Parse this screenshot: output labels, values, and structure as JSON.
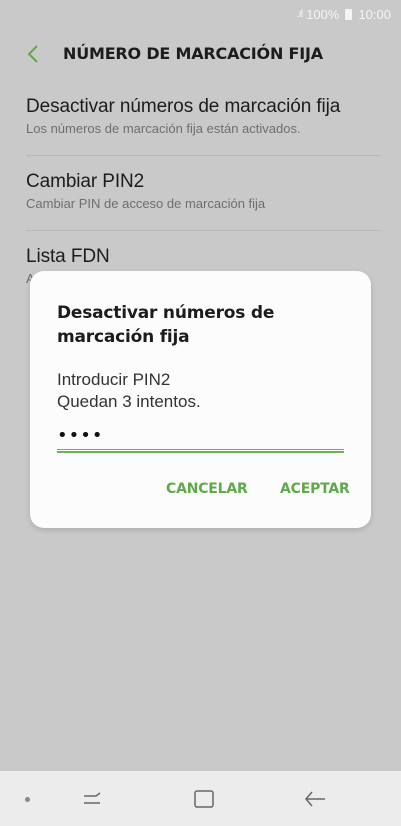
{
  "status_bar": {
    "signal": ".ıl",
    "battery": "100%",
    "time": "10:00"
  },
  "header": {
    "title": "NÚMERO DE MARCACIÓN FIJA"
  },
  "list": {
    "items": [
      {
        "title": "Desactivar números de marcación fija",
        "subtitle": "Los números de marcación fija están activados."
      },
      {
        "title": "Cambiar PIN2",
        "subtitle": "Cambiar PIN de acceso de marcación fija"
      },
      {
        "title": "Lista FDN",
        "subtitle": "A"
      }
    ]
  },
  "dialog": {
    "title": "Desactivar números de marcación fija",
    "message_line1": "Introducir PIN2",
    "message_line2": "Quedan 3 intentos.",
    "pin_value": "••••",
    "cancel_label": "CANCELAR",
    "accept_label": "ACEPTAR"
  },
  "colors": {
    "accent": "#5fa84c",
    "dim_background": "#c9c9c9",
    "dialog_background": "#fcfcfc"
  },
  "nav_bar": {
    "icons": [
      "dot-icon",
      "recent-apps-icon",
      "home-icon",
      "back-icon"
    ]
  }
}
